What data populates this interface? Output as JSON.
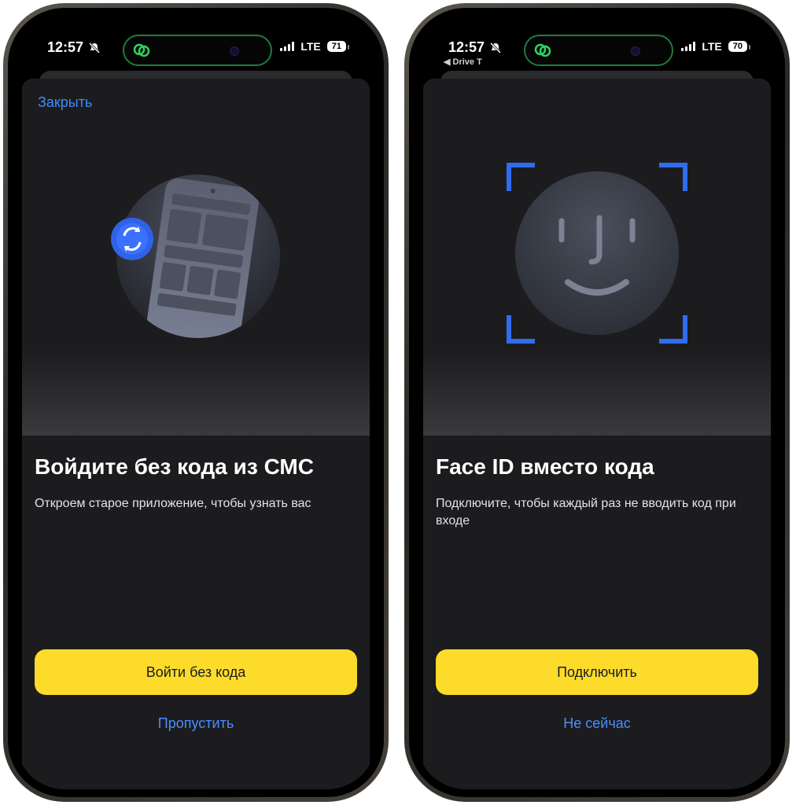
{
  "phones": [
    {
      "status": {
        "time": "12:57",
        "sub_label": "",
        "network": "LTE",
        "battery": "71"
      },
      "close_label": "Закрыть",
      "title": "Войдите без кода из СМС",
      "description": "Откроем старое приложение, чтобы узнать вас",
      "primary_button": "Войти без кода",
      "secondary_button": "Пропустить",
      "illustration": "phone-sync-icon"
    },
    {
      "status": {
        "time": "12:57",
        "sub_label": "◀ Drive T",
        "network": "LTE",
        "battery": "70"
      },
      "close_label": "",
      "title": "Face ID вместо кода",
      "description": "Подключите, чтобы каждый раз не вводить код при входе",
      "primary_button": "Подключить",
      "secondary_button": "Не сейчас",
      "illustration": "face-id-icon"
    }
  ],
  "colors": {
    "accent_yellow": "#fddb2a",
    "link_blue": "#3d8bff",
    "sheet_bg": "#1c1c1e",
    "faceid_blue": "#2f6cf0"
  }
}
